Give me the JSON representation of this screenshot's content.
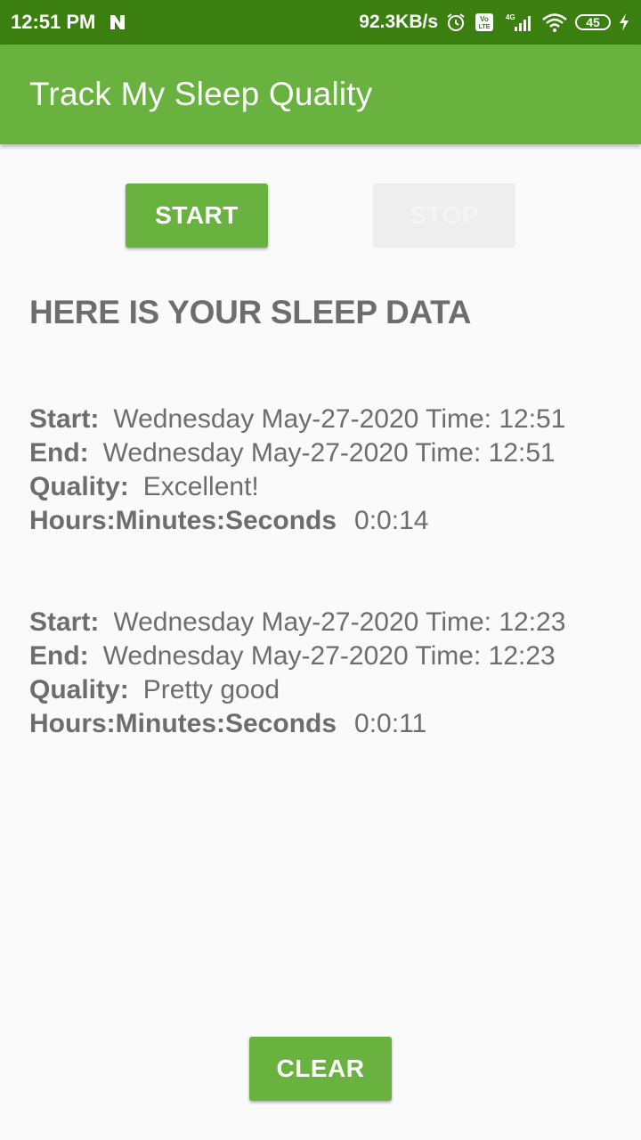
{
  "status_bar": {
    "time": "12:51 PM",
    "net_speed": "92.3KB/s",
    "signal_label": "4G",
    "volte": "Vo LTE",
    "battery": "45"
  },
  "app_bar": {
    "title": "Track My Sleep Quality"
  },
  "buttons": {
    "start": "START",
    "stop": "STOP",
    "clear": "CLEAR"
  },
  "heading": "HERE IS YOUR SLEEP DATA",
  "records": [
    {
      "start_label": "Start:",
      "start": "Wednesday May-27-2020 Time: 12:51",
      "end_label": "End:",
      "end": "Wednesday May-27-2020 Time: 12:51",
      "quality_label": "Quality:",
      "quality": "Excellent!",
      "duration_label": "Hours:Minutes:Seconds",
      "duration": "0:0:14"
    },
    {
      "start_label": "Start:",
      "start": "Wednesday May-27-2020 Time: 12:23",
      "end_label": "End:",
      "end": "Wednesday May-27-2020 Time: 12:23",
      "quality_label": "Quality:",
      "quality": "Pretty good",
      "duration_label": "Hours:Minutes:Seconds",
      "duration": "0:0:11"
    }
  ],
  "colors": {
    "primary": "#69b240",
    "primary_dark": "#3a7f0f",
    "text": "#6d6d6d",
    "background": "#fafafa"
  }
}
